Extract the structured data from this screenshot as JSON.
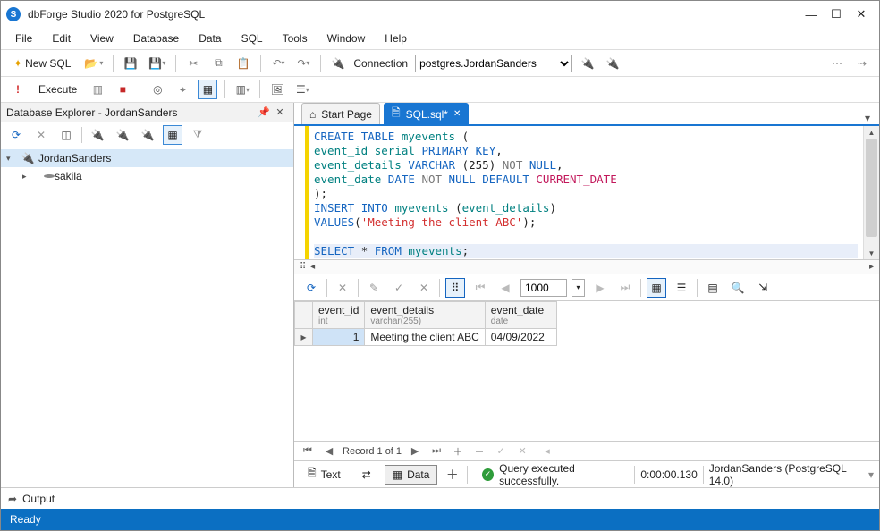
{
  "app": {
    "title": "dbForge Studio 2020 for PostgreSQL",
    "logo_letter": "S"
  },
  "menu": [
    "File",
    "Edit",
    "View",
    "Database",
    "Data",
    "SQL",
    "Tools",
    "Window",
    "Help"
  ],
  "toolbar1": {
    "new_sql": "New SQL",
    "connection_label": "Connection",
    "connection_value": "postgres.JordanSanders"
  },
  "toolbar2": {
    "execute": "Execute"
  },
  "explorer": {
    "title": "Database Explorer - JordanSanders",
    "root": "JordanSanders",
    "children": [
      "sakila"
    ]
  },
  "tabs": {
    "start": "Start Page",
    "sql": "SQL.sql*"
  },
  "sql_tokens": [
    [
      [
        "kw",
        "CREATE"
      ],
      [
        "sp",
        " "
      ],
      [
        "kw",
        "TABLE"
      ],
      [
        "sp",
        " "
      ],
      [
        "ident",
        "myevents"
      ],
      [
        "sp",
        " "
      ],
      [
        "punc",
        "("
      ]
    ],
    [
      [
        "ident",
        "event_id"
      ],
      [
        "sp",
        " "
      ],
      [
        "ident",
        "serial"
      ],
      [
        "sp",
        " "
      ],
      [
        "kw",
        "PRIMARY"
      ],
      [
        "sp",
        " "
      ],
      [
        "kw",
        "KEY"
      ],
      [
        "punc",
        ","
      ]
    ],
    [
      [
        "ident",
        "event_details"
      ],
      [
        "sp",
        " "
      ],
      [
        "kw",
        "VARCHAR"
      ],
      [
        "sp",
        " "
      ],
      [
        "punc",
        "("
      ],
      [
        "num",
        "255"
      ],
      [
        "punc",
        ")"
      ],
      [
        "sp",
        " "
      ],
      [
        "gray",
        "NOT"
      ],
      [
        "sp",
        " "
      ],
      [
        "kw",
        "NULL"
      ],
      [
        "punc",
        ","
      ]
    ],
    [
      [
        "ident",
        "event_date"
      ],
      [
        "sp",
        " "
      ],
      [
        "kw",
        "DATE"
      ],
      [
        "sp",
        " "
      ],
      [
        "gray",
        "NOT"
      ],
      [
        "sp",
        " "
      ],
      [
        "kw",
        "NULL"
      ],
      [
        "sp",
        " "
      ],
      [
        "kw",
        "DEFAULT"
      ],
      [
        "sp",
        " "
      ],
      [
        "func",
        "CURRENT_DATE"
      ]
    ],
    [
      [
        "punc",
        ");"
      ]
    ],
    [
      [
        "kw",
        "INSERT"
      ],
      [
        "sp",
        " "
      ],
      [
        "kw",
        "INTO"
      ],
      [
        "sp",
        " "
      ],
      [
        "ident",
        "myevents"
      ],
      [
        "sp",
        " "
      ],
      [
        "punc",
        "("
      ],
      [
        "ident",
        "event_details"
      ],
      [
        "punc",
        ")"
      ]
    ],
    [
      [
        "kw",
        "VALUES"
      ],
      [
        "punc",
        "("
      ],
      [
        "str",
        "'Meeting the client ABC'"
      ],
      [
        "punc",
        ");"
      ]
    ],
    [],
    [
      [
        "kw",
        "SELECT"
      ],
      [
        "sp",
        " "
      ],
      [
        "punc",
        "*"
      ],
      [
        "sp",
        " "
      ],
      [
        "kw",
        "FROM"
      ],
      [
        "sp",
        " "
      ],
      [
        "ident",
        "myevents"
      ],
      [
        "punc",
        ";"
      ]
    ]
  ],
  "results_toolbar": {
    "page_size": "1000"
  },
  "grid": {
    "columns": [
      {
        "name": "event_id",
        "type": "int"
      },
      {
        "name": "event_details",
        "type": "varchar(255)"
      },
      {
        "name": "event_date",
        "type": "date"
      }
    ],
    "rows": [
      {
        "event_id": "1",
        "event_details": "Meeting the client ABC",
        "event_date": "04/09/2022"
      }
    ]
  },
  "gridnav": {
    "record": "Record 1 of 1"
  },
  "resultfooter": {
    "text_tab": "Text",
    "data_tab": "Data",
    "status": "Query executed successfully.",
    "elapsed": "0:00:00.130",
    "conn": "JordanSanders (PostgreSQL 14.0)"
  },
  "output": {
    "label": "Output"
  },
  "statusbar": {
    "text": "Ready"
  }
}
